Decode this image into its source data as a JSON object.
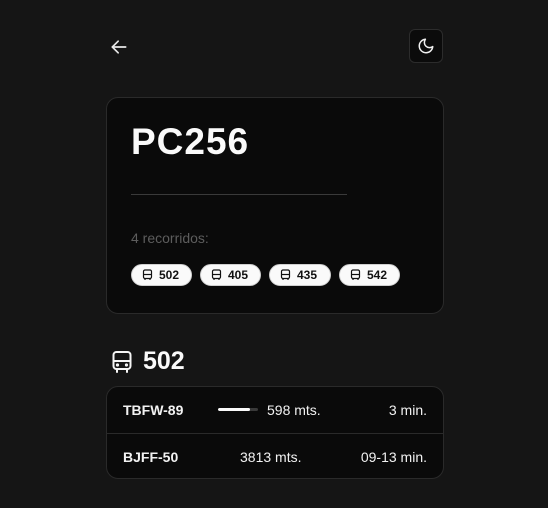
{
  "header": {
    "back_icon": "arrow-left-icon",
    "theme_icon": "moon-icon"
  },
  "stop": {
    "code": "PC256",
    "routes_count_label": "4 recorridos:",
    "routes": [
      {
        "label": "502",
        "icon": "bus-icon"
      },
      {
        "label": "405",
        "icon": "bus-icon"
      },
      {
        "label": "435",
        "icon": "bus-icon"
      },
      {
        "label": "542",
        "icon": "bus-icon"
      }
    ]
  },
  "selected_route": {
    "number": "502",
    "icon": "bus-icon",
    "arrivals": [
      {
        "plate": "TBFW-89",
        "distance": "598 mts.",
        "eta": "3 min.",
        "progress": 0.8
      },
      {
        "plate": "BJFF-50",
        "distance": "3813 mts.",
        "eta": "09-13 min."
      }
    ]
  }
}
